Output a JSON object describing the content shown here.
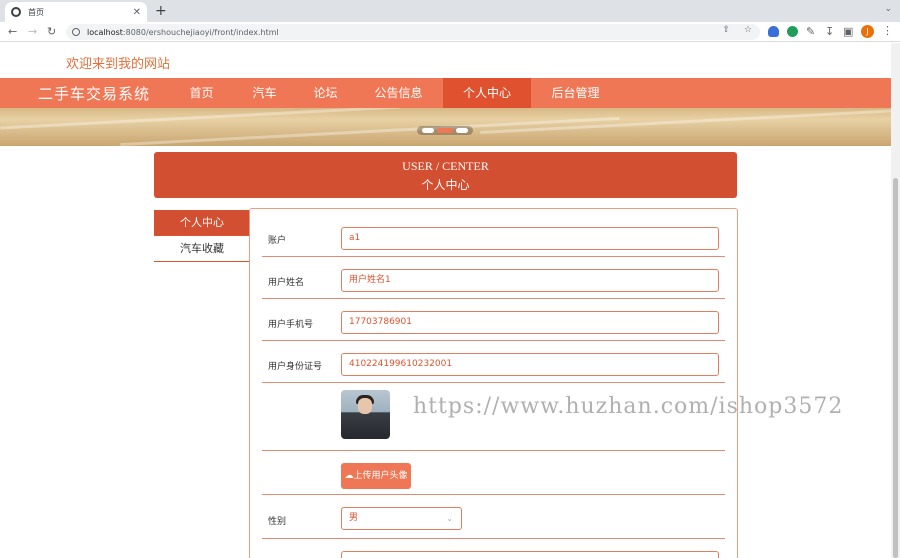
{
  "browser": {
    "tab_title": "首页",
    "tab_close": "✕",
    "new_tab": "+",
    "url_host": "localhost",
    "url_path": ":8080/ershouchejiaoyi/front/index.html",
    "profile_initial": "J"
  },
  "site": {
    "welcome": "欢迎来到我的网站",
    "brand": "二手车交易系统",
    "nav": [
      {
        "label": "首页",
        "active": false
      },
      {
        "label": "汽车",
        "active": false
      },
      {
        "label": "论坛",
        "active": false
      },
      {
        "label": "公告信息",
        "active": false
      },
      {
        "label": "个人中心",
        "active": true
      },
      {
        "label": "后台管理",
        "active": false
      }
    ],
    "accent_color": "#f07755",
    "dark_accent_color": "#d34f31"
  },
  "user_center": {
    "title_en": "USER / CENTER",
    "title_cn": "个人中心",
    "side_menu": [
      {
        "label": "个人中心",
        "active": true
      },
      {
        "label": "汽车收藏",
        "active": false
      }
    ]
  },
  "form": {
    "account_label": "账户",
    "account_value": "a1",
    "name_label": "用户姓名",
    "name_value": "用户姓名1",
    "phone_label": "用户手机号",
    "phone_value": "17703786901",
    "idcard_label": "用户身份证号",
    "idcard_value": "410224199610232001",
    "upload_label": "上传用户头像",
    "gender_label": "性别",
    "gender_value": "男"
  },
  "watermark": "https://www.huzhan.com/ishop3572"
}
